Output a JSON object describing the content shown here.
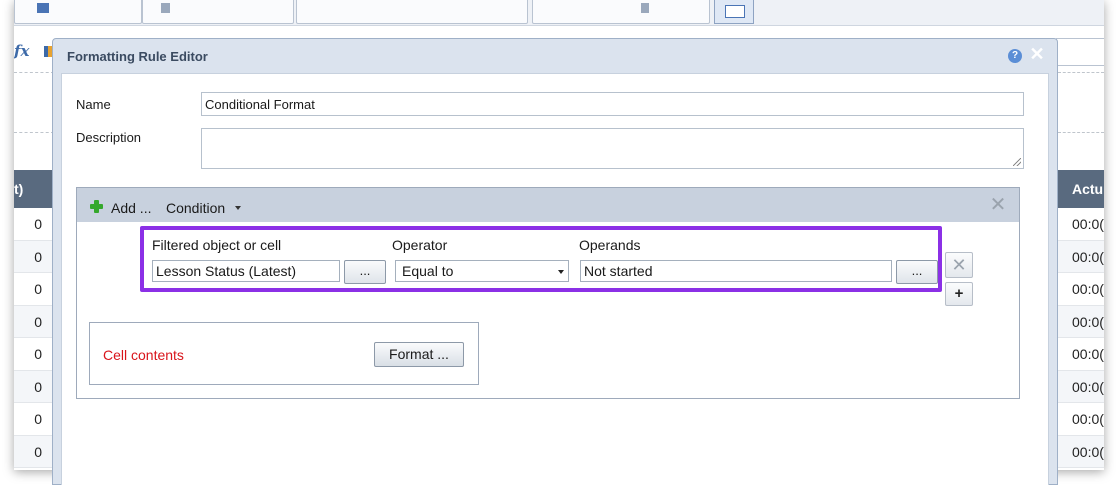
{
  "background": {
    "left_column": {
      "header": "t)",
      "values": [
        "0",
        "0",
        "0",
        "0",
        "0",
        "0",
        "0",
        "0"
      ]
    },
    "right_column": {
      "header": "Actu",
      "values": [
        "00:0(",
        "00:0(",
        "00:0(",
        "00:0(",
        "00:0(",
        "00:0(",
        "00:0(",
        "00:0("
      ]
    }
  },
  "dialog": {
    "title": "Formatting Rule Editor",
    "help_symbol": "?",
    "close_symbol": "✕",
    "name_label": "Name",
    "name_value": "Conditional Format",
    "description_label": "Description",
    "description_value": "",
    "condition_panel": {
      "add_label": "Add ...",
      "condition_label": "Condition",
      "close_symbol": "✕",
      "filtered_label": "Filtered object or cell",
      "filtered_value": "Lesson Status (Latest)",
      "ellipsis_label": "...",
      "operator_label": "Operator",
      "operator_value": "Equal to",
      "operands_label": "Operands",
      "operands_value": "Not started",
      "remove_row_symbol": "✕",
      "add_row_symbol": "+"
    },
    "cell_contents_label": "Cell contents",
    "format_button_label": "Format ..."
  },
  "colors": {
    "highlight_border": "#8b30e6",
    "cell_contents_text": "#d9141b",
    "add_icon": "#35a82c",
    "header_bg": "#596a7f"
  }
}
